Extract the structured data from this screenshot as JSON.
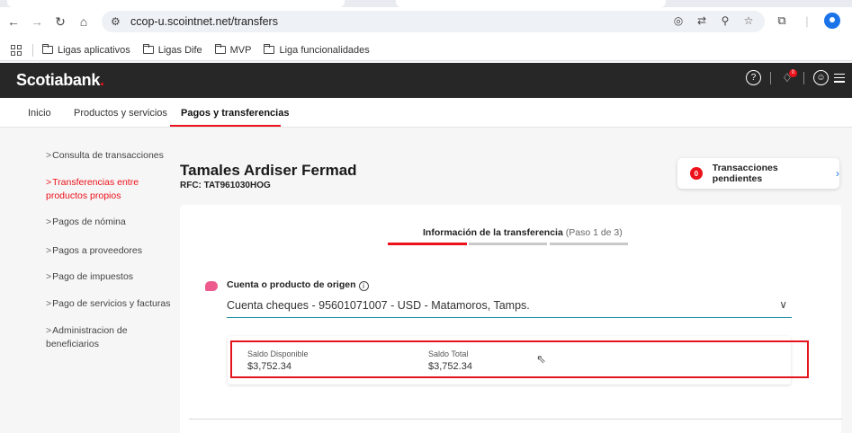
{
  "browser": {
    "url": "ccop-u.scointnet.net/transfers",
    "bookmarks": [
      "Ligas aplicativos",
      "Ligas Dife",
      "MVP",
      "Liga funcionalidades"
    ]
  },
  "header": {
    "logo_text": "Scotiabank",
    "logo_dot": ".",
    "help_icon_text": "?",
    "notification_badge": "0",
    "accent": "#ec111a"
  },
  "top_nav": {
    "items": [
      "Inicio",
      "Productos y servicios",
      "Pagos y transferencias"
    ],
    "active": "Pagos y transferencias"
  },
  "sidebar": {
    "items": [
      {
        "label": "Consulta de transacciones"
      },
      {
        "label": "Transferencias entre",
        "label2": "productos propios",
        "active": true
      },
      {
        "label": "Pagos de nómina"
      },
      {
        "label": "Pagos a proveedores"
      },
      {
        "label": "Pago de impuestos"
      },
      {
        "label": "Pago de servicios y facturas"
      },
      {
        "label": "Administracion de",
        "label2": "beneficiarios"
      }
    ]
  },
  "customer": {
    "name": "Tamales Ardiser Fermad",
    "rfc": "RFC: TAT961030HOG"
  },
  "pending": {
    "count": "0",
    "label": "Transacciones pendientes",
    "arrow": "›"
  },
  "steps": {
    "title": "Información de la transferencia",
    "subtitle": "(Paso 1 de 3)"
  },
  "origin": {
    "label": "Cuenta o producto de origen",
    "info_icon_text": "i",
    "value": "Cuenta cheques - 95601071007 - USD - Matamoros, Tamps."
  },
  "balances": {
    "available_label": "Saldo Disponible",
    "available_value": "$3,752.34",
    "total_label": "Saldo Total",
    "total_value": "$3,752.34"
  }
}
